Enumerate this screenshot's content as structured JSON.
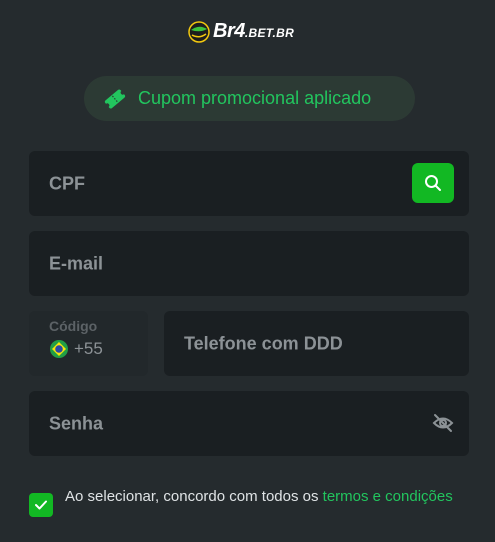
{
  "logo": {
    "main": "Br4",
    "sub": ".BET.BR"
  },
  "promo": {
    "icon": "ticket-icon",
    "text": "Cupom promocional aplicado"
  },
  "form": {
    "cpf_label": "CPF",
    "search_icon": "search-icon",
    "email_label": "E-mail",
    "code_label": "Código",
    "code_value": "+55",
    "flag_icon": "brazil-flag-icon",
    "phone_label": "Telefone com DDD",
    "password_label": "Senha",
    "eye_icon": "eye-off-icon"
  },
  "terms": {
    "checked": true,
    "text": "Ao selecionar, concordo com todos os ",
    "link": "termos e condições"
  },
  "colors": {
    "accent": "#12b823",
    "link": "#22c55e",
    "background": "#252b2e"
  }
}
